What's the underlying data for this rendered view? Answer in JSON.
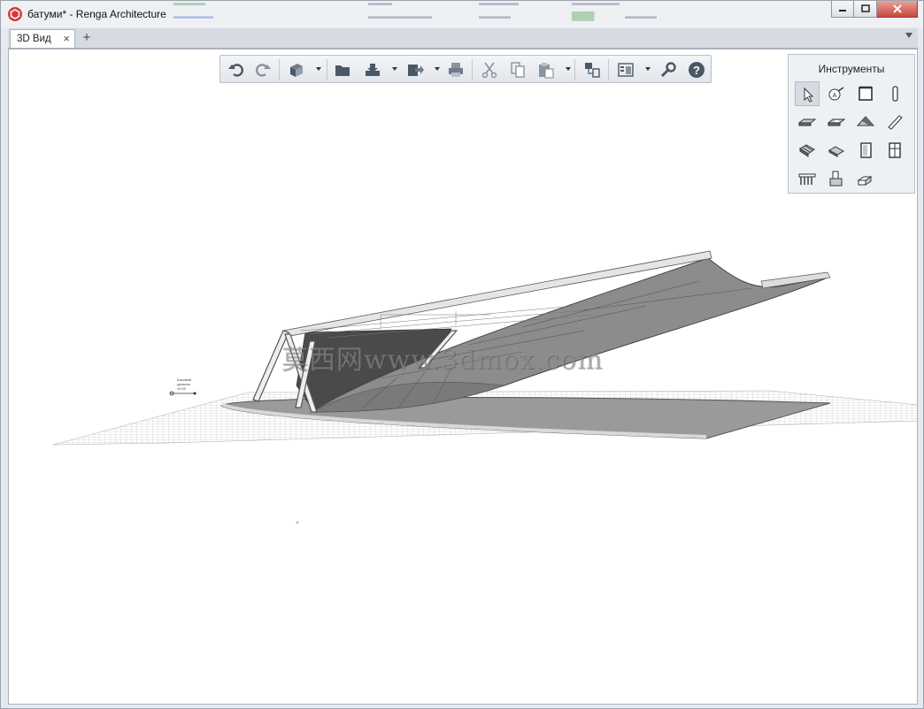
{
  "window": {
    "title": "батуми* - Renga Architecture",
    "buttons": [
      "minimize",
      "maximize",
      "close"
    ]
  },
  "tabs": {
    "items": [
      {
        "label": "3D Вид",
        "close": "×"
      }
    ],
    "add_label": "+"
  },
  "toolbar": {
    "buttons": [
      "undo-icon",
      "redo-icon",
      "view-3d-icon",
      "open-folder-icon",
      "save-icon",
      "export-icon",
      "print-icon",
      "cut-icon",
      "copy-icon",
      "paste-icon",
      "project-browser-icon",
      "layers-icon",
      "settings-wrench-icon",
      "help-icon"
    ]
  },
  "tools_panel": {
    "title": "Инструменты",
    "tools": [
      "select-arrow-icon",
      "axis-grid-icon",
      "wall-icon",
      "column-icon",
      "slab-icon",
      "opening-icon",
      "roof-icon",
      "beam-icon",
      "stair-icon",
      "ramp-icon",
      "door-icon",
      "window-icon",
      "railing-icon",
      "equipment-icon",
      "duct-icon"
    ]
  },
  "viewport": {
    "watermark": "莫西网www.3dmox.com",
    "axis_marker_lines": [
      "Базовый",
      "уровень",
      "±0.00"
    ]
  }
}
